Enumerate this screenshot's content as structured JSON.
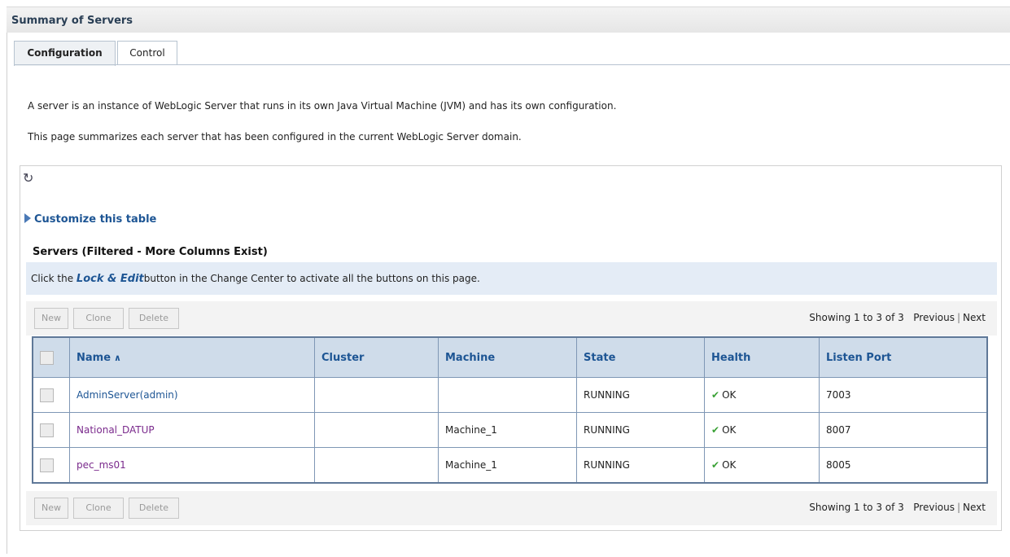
{
  "page": {
    "title": "Summary of Servers"
  },
  "tabs": [
    {
      "label": "Configuration",
      "active": true
    },
    {
      "label": "Control",
      "active": false
    }
  ],
  "intro": {
    "line1": "A server is an instance of WebLogic Server that runs in its own Java Virtual Machine (JVM) and has its own configuration.",
    "line2": "This page summarizes each server that has been configured in the current WebLogic Server domain."
  },
  "customize_link": "Customize this table",
  "table_title": "Servers (Filtered - More Columns Exist)",
  "notice": {
    "prefix": "Click the ",
    "lock_edit": "Lock & Edit",
    "suffix": "button in the Change Center to activate all the buttons on this page."
  },
  "buttons": {
    "new": "New",
    "clone": "Clone",
    "delete": "Delete"
  },
  "paging": {
    "showing": "Showing 1 to 3 of 3",
    "previous": "Previous",
    "separator": "|",
    "next": "Next"
  },
  "columns": {
    "name": "Name",
    "cluster": "Cluster",
    "machine": "Machine",
    "state": "State",
    "health": "Health",
    "listen_port": "Listen Port"
  },
  "rows": [
    {
      "name": "AdminServer(admin)",
      "cluster": "",
      "machine": "",
      "state": "RUNNING",
      "health": "OK",
      "listen_port": "7003"
    },
    {
      "name": "National_DATUP",
      "cluster": "",
      "machine": "Machine_1",
      "state": "RUNNING",
      "health": "OK",
      "listen_port": "8007"
    },
    {
      "name": "pec_ms01",
      "cluster": "",
      "machine": "Machine_1",
      "state": "RUNNING",
      "health": "OK",
      "listen_port": "8005"
    }
  ],
  "colors": {
    "link_blue": "#1d5594",
    "visited_purple": "#7a2a8c",
    "header_bg": "#cfdcea",
    "notice_bg": "#e4ecf6",
    "ok_green": "#3aa136"
  },
  "icons": {
    "refresh": "refresh-icon",
    "sort": "sort-ascending-icon",
    "health_ok": "checkmark-icon",
    "expand": "expand-triangle-icon"
  }
}
